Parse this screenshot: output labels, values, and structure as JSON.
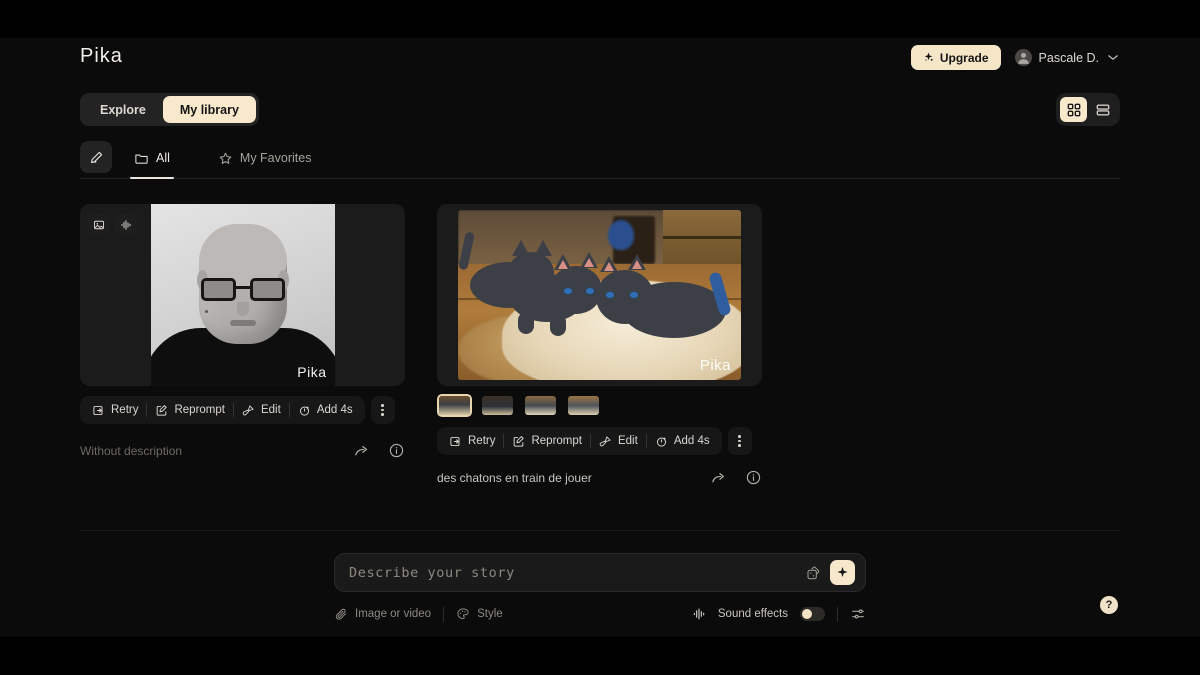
{
  "app": {
    "brand": "Pika"
  },
  "header": {
    "upgrade_label": "Upgrade",
    "upgrade_icon": "sparkle-icon",
    "account_name": "Pascale D.",
    "account_chevron": "chevron-down-icon",
    "avatar_icon": "user-avatar-icon"
  },
  "nav": {
    "segments": [
      {
        "label": "Explore",
        "active": false
      },
      {
        "label": "My library",
        "active": true
      }
    ],
    "view_modes": [
      {
        "name": "grid-view",
        "icon": "grid-icon",
        "active": true
      },
      {
        "name": "list-view",
        "icon": "list-icon",
        "active": false
      }
    ]
  },
  "filters": {
    "compose_icon": "pencil-icon",
    "tabs": [
      {
        "label": "All",
        "icon": "folder-icon",
        "active": true
      },
      {
        "label": "My Favorites",
        "icon": "star-icon",
        "active": false
      }
    ]
  },
  "cards": [
    {
      "id": "card-portrait",
      "badges": [
        "image-icon",
        "sound-wave-icon"
      ],
      "watermark": "Pika",
      "caption": "Without description",
      "caption_empty": true,
      "has_thumbnails": false,
      "actions": [
        {
          "label": "Retry",
          "icon": "retry-icon"
        },
        {
          "label": "Reprompt",
          "icon": "reprompt-icon"
        },
        {
          "label": "Edit",
          "icon": "brush-icon"
        },
        {
          "label": "Add 4s",
          "icon": "stopwatch-icon"
        }
      ],
      "more_label": "more-options",
      "share_icon": "share-icon",
      "info_icon": "info-icon"
    },
    {
      "id": "card-kittens",
      "badges": [],
      "watermark": "Pika",
      "caption": "des chatons en train de jouer",
      "caption_empty": false,
      "has_thumbnails": true,
      "thumbnails": [
        {
          "name": "thumbnail-1",
          "active": true
        },
        {
          "name": "thumbnail-2",
          "active": false
        },
        {
          "name": "thumbnail-3",
          "active": false
        },
        {
          "name": "thumbnail-4",
          "active": false
        }
      ],
      "actions": [
        {
          "label": "Retry",
          "icon": "retry-icon"
        },
        {
          "label": "Reprompt",
          "icon": "reprompt-icon"
        },
        {
          "label": "Edit",
          "icon": "brush-icon"
        },
        {
          "label": "Add 4s",
          "icon": "stopwatch-icon"
        }
      ],
      "more_label": "more-options",
      "share_icon": "share-icon",
      "info_icon": "info-icon"
    }
  ],
  "prompt": {
    "placeholder": "Describe your story",
    "value": "",
    "dice_icon": "dice-icon",
    "submit_icon": "sparkle-icon",
    "tools_left": [
      {
        "label": "Image or video",
        "icon": "paperclip-icon"
      },
      {
        "label": "Style",
        "icon": "palette-icon"
      }
    ],
    "sound_effects_label": "Sound effects",
    "sound_effects_icon": "sound-wave-icon",
    "sound_effects_on": false,
    "settings_icon": "sliders-icon"
  },
  "help": {
    "label": "?"
  },
  "colors": {
    "accent_cream": "#f7e8cb",
    "background": "#0b0b0b",
    "surface": "#1b1b1b",
    "text_primary": "#e8e6e3",
    "text_muted": "#8d8982"
  }
}
